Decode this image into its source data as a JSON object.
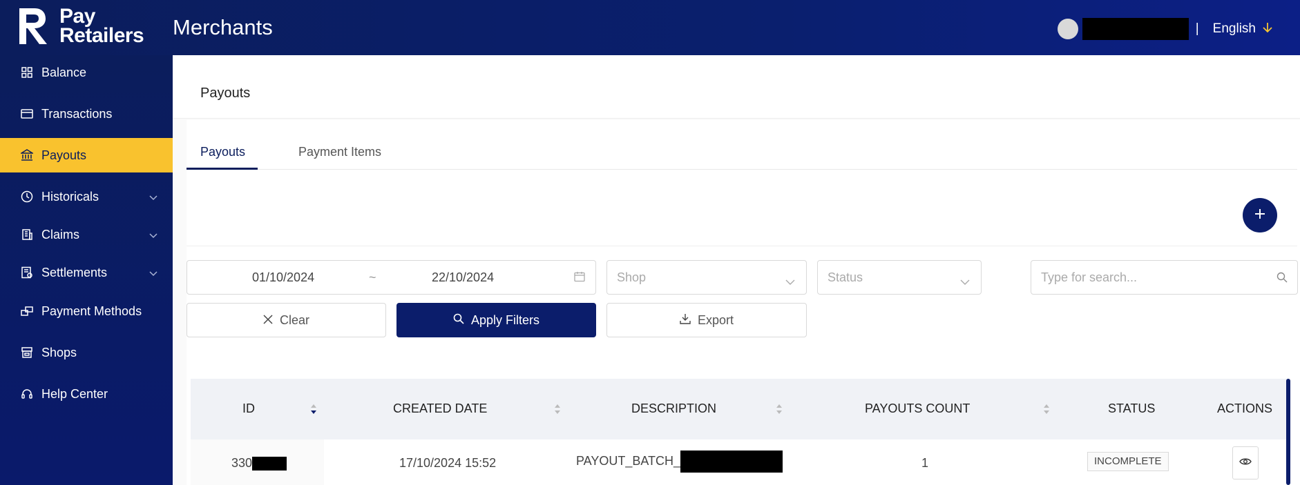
{
  "header": {
    "logo_text_line1": "Pay",
    "logo_text_line2": "Retailers",
    "app_title": "Merchants",
    "separator": "|",
    "language": "English",
    "language_icon": "arrow-down-icon"
  },
  "sidebar": {
    "items": [
      {
        "label": "Balance",
        "icon": "grid-icon",
        "expandable": false,
        "active": false
      },
      {
        "label": "Transactions",
        "icon": "card-icon",
        "expandable": false,
        "active": false
      },
      {
        "label": "Payouts",
        "icon": "bank-icon",
        "expandable": false,
        "active": true
      },
      {
        "label": "Historicals",
        "icon": "clock-icon",
        "expandable": true,
        "active": false
      },
      {
        "label": "Claims",
        "icon": "building-icon",
        "expandable": true,
        "active": false
      },
      {
        "label": "Settlements",
        "icon": "receipt-icon",
        "expandable": true,
        "active": false
      },
      {
        "label": "Payment Methods",
        "icon": "cards-stack-icon",
        "expandable": false,
        "active": false
      },
      {
        "label": "Shops",
        "icon": "shop-icon",
        "expandable": false,
        "active": false
      },
      {
        "label": "Help Center",
        "icon": "headset-icon",
        "expandable": false,
        "active": false
      }
    ]
  },
  "page": {
    "title": "Payouts",
    "tabs": [
      {
        "label": "Payouts",
        "active": true
      },
      {
        "label": "Payment Items",
        "active": false
      }
    ]
  },
  "filters": {
    "date_start": "01/10/2024",
    "date_separator": "~",
    "date_end": "22/10/2024",
    "shop_placeholder": "Shop",
    "status_placeholder": "Status",
    "search_placeholder": "Type for search...",
    "clear_label": "Clear",
    "apply_label": "Apply Filters",
    "export_label": "Export"
  },
  "table": {
    "columns": [
      "ID",
      "CREATED DATE",
      "DESCRIPTION",
      "PAYOUTS COUNT",
      "STATUS",
      "ACTIONS"
    ],
    "rows": [
      {
        "id_visible": "330",
        "created_date": "17/10/2024 15:52",
        "description_visible": "PAYOUT_BATCH_",
        "payouts_count": "1",
        "status": "INCOMPLETE"
      }
    ]
  },
  "colors": {
    "navy": "#0b1d6b",
    "accent_yellow": "#f9c22e"
  }
}
